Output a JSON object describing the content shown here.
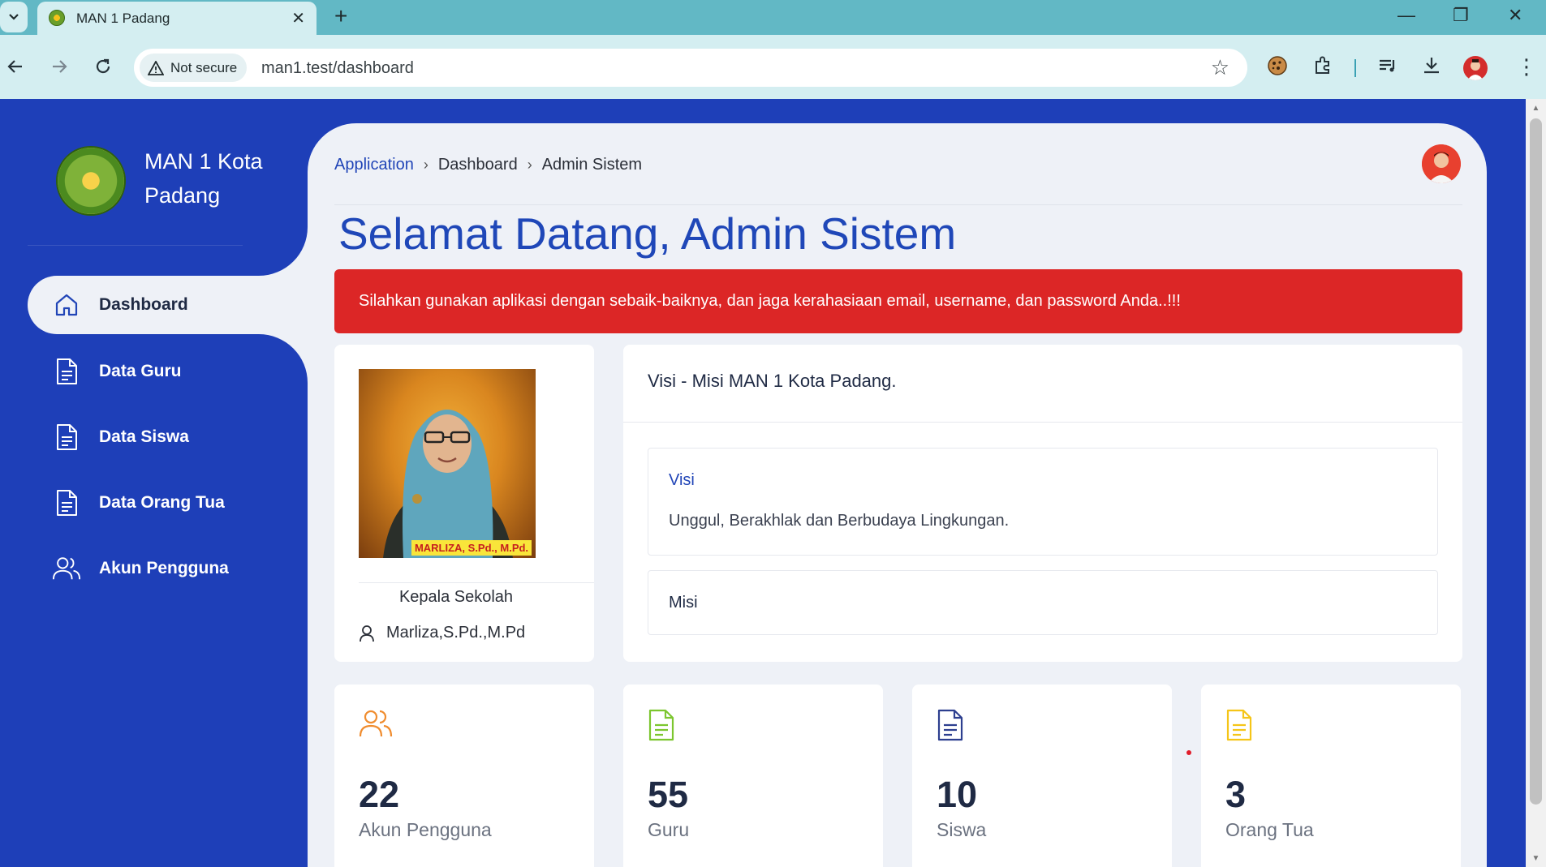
{
  "browser": {
    "tab_title": "MAN 1 Padang",
    "security_label": "Not secure",
    "url": "man1.test/dashboard"
  },
  "sidebar": {
    "brand": "MAN 1 Kota Padang",
    "items": [
      {
        "label": "Dashboard",
        "icon": "home-icon",
        "active": true
      },
      {
        "label": "Data Guru",
        "icon": "document-icon"
      },
      {
        "label": "Data Siswa",
        "icon": "document-icon"
      },
      {
        "label": "Data Orang Tua",
        "icon": "document-icon"
      },
      {
        "label": "Akun Pengguna",
        "icon": "users-icon"
      }
    ]
  },
  "header": {
    "breadcrumb": [
      "Application",
      "Dashboard",
      "Admin Sistem"
    ]
  },
  "main": {
    "welcome": "Selamat Datang, Admin Sistem",
    "alert": "Silahkan gunakan aplikasi dengan sebaik-baiknya, dan jaga kerahasiaan email, username, dan password Anda..!!!",
    "principal": {
      "photo_caption": "MARLIZA, S.Pd., M.Pd.",
      "role": "Kepala Sekolah",
      "name": "Marliza,S.Pd.,M.Pd"
    },
    "vision": {
      "title": "Visi - Misi MAN 1 Kota Padang.",
      "visi_label": "Visi",
      "visi_text": "Unggul, Berakhlak dan Berbudaya Lingkungan.",
      "misi_label": "Misi"
    },
    "stats": [
      {
        "value": "22",
        "label": "Akun Pengguna",
        "icon": "users-icon",
        "color": "#f08c2e"
      },
      {
        "value": "55",
        "label": "Guru",
        "icon": "document-icon",
        "color": "#7cc62f"
      },
      {
        "value": "10",
        "label": "Siswa",
        "icon": "document-icon",
        "color": "#2d3f8f"
      },
      {
        "value": "3",
        "label": "Orang Tua",
        "icon": "document-icon",
        "color": "#f5c518"
      }
    ]
  },
  "colors": {
    "sidebar": "#1e3fb8",
    "alert": "#dc2626",
    "accent": "#2145b7"
  }
}
